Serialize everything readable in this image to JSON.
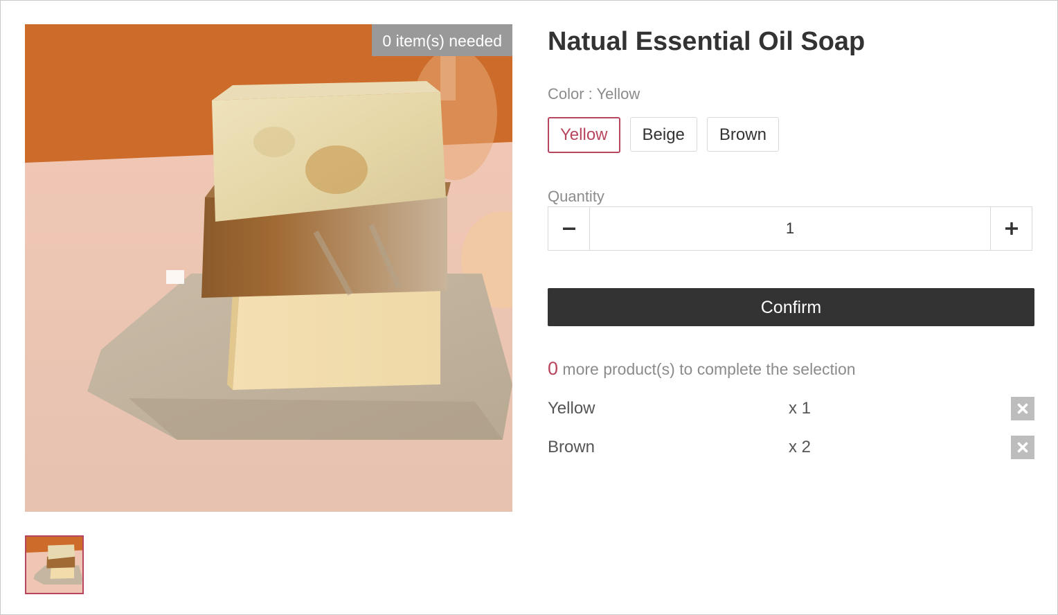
{
  "product": {
    "title": "Natual Essential Oil Soap",
    "image_alt": "Stack of three handmade soap bars on a linen cloth",
    "badge": "0 item(s) needed"
  },
  "color": {
    "label": "Color : Yellow",
    "options": [
      "Yellow",
      "Beige",
      "Brown"
    ],
    "selected": "Yellow"
  },
  "quantity": {
    "label": "Quantity",
    "value": "1",
    "minus_symbol": "−",
    "plus_symbol": "+"
  },
  "confirm_label": "Confirm",
  "remaining": {
    "count": "0",
    "text": "more product(s) to complete the selection"
  },
  "selections": [
    {
      "name": "Yellow",
      "count": "x 1"
    },
    {
      "name": "Brown",
      "count": "x 2"
    }
  ],
  "colors": {
    "accent": "#b8455e",
    "button_dark": "#333333",
    "badge_bg": "#999999",
    "remove_bg": "#bdbdbd"
  },
  "icons": {
    "remove": "close-icon",
    "decrement": "minus-icon",
    "increment": "plus-icon"
  }
}
